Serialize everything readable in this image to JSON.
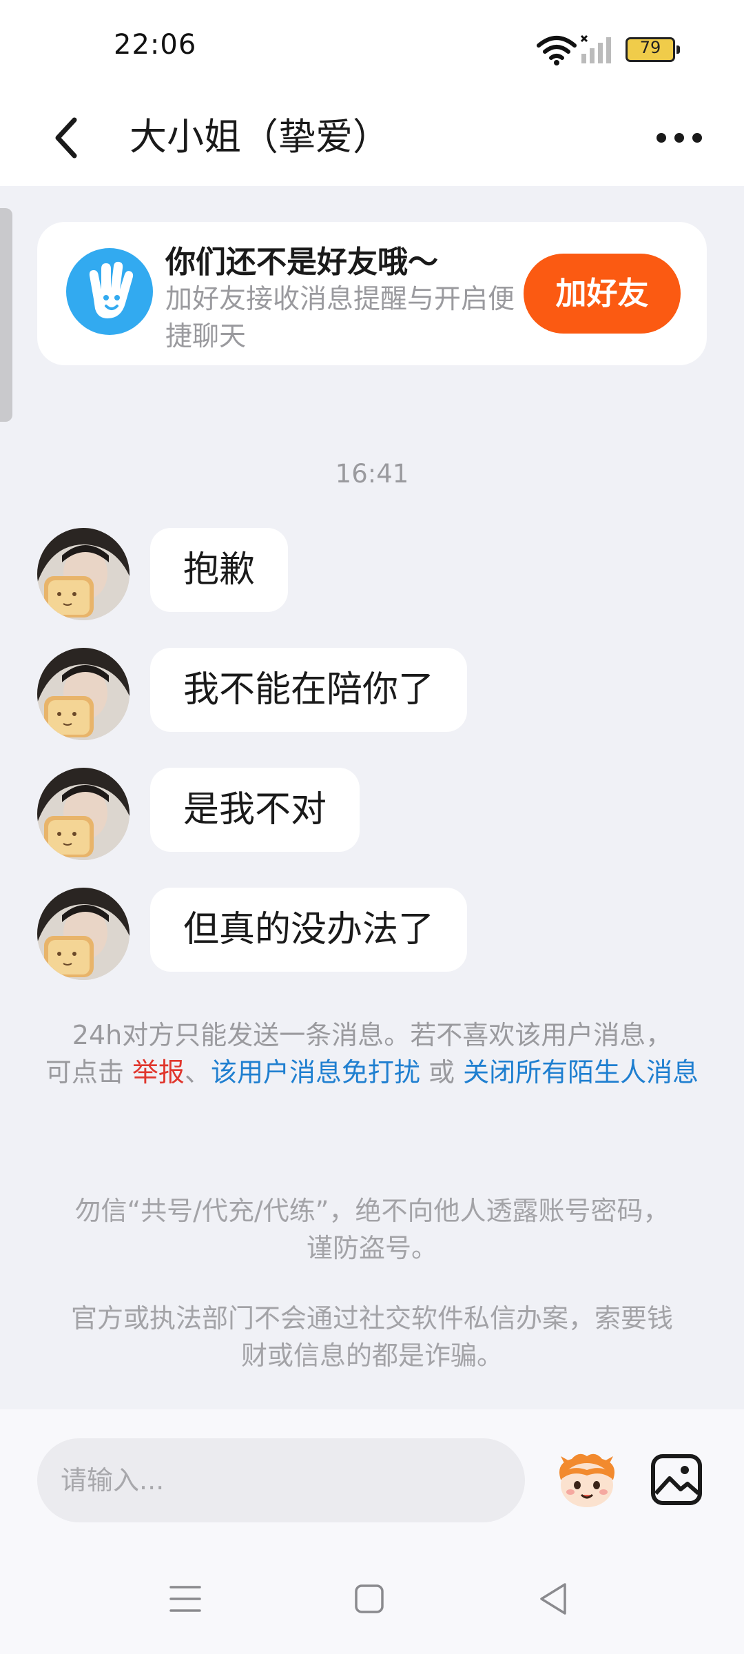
{
  "status_bar": {
    "time": "22:06",
    "battery": "79",
    "icons": [
      "wifi-icon",
      "signal-icon",
      "battery-icon"
    ]
  },
  "header": {
    "title": "大小姐（挚爱）",
    "icons": [
      "back-arrow-icon",
      "more-options-icon"
    ]
  },
  "friend_card": {
    "title": "你们还不是好友哦～",
    "subtitle": "加好友接收消息提醒与开启便捷聊天",
    "button_label": "加好友",
    "icon": "waving-hand-icon",
    "accent_color": "#fb5a12"
  },
  "chat": {
    "timestamp": "16:41",
    "messages": [
      {
        "text": "抱歉"
      },
      {
        "text": "我不能在陪你了"
      },
      {
        "text": "是我不对"
      },
      {
        "text": "但真的没办法了"
      }
    ]
  },
  "notice": {
    "line1": "24h对方只能发送一条消息。若不喜欢该用户消息，",
    "prefix": "可点击 ",
    "report_link": "举报",
    "separator": "、",
    "mute_link": "该用户消息免打扰",
    "or_text": " 或 ",
    "close_link": "关闭所有陌生人消息",
    "link_red": "#e0362d",
    "link_blue": "#1f7fd0"
  },
  "safety": {
    "warning1": "勿信“共号/代充/代练”，绝不向他人透露账号密码，谨防盗号。",
    "warning2": "官方或执法部门不会通过社交软件私信办案，索要钱财或信息的都是诈骗。"
  },
  "input_bar": {
    "placeholder": "请输入...",
    "icons": [
      "emoji-sticker-icon",
      "image-icon"
    ]
  },
  "nav_bar": {
    "icons": [
      "menu-icon",
      "home-icon",
      "back-icon"
    ]
  }
}
